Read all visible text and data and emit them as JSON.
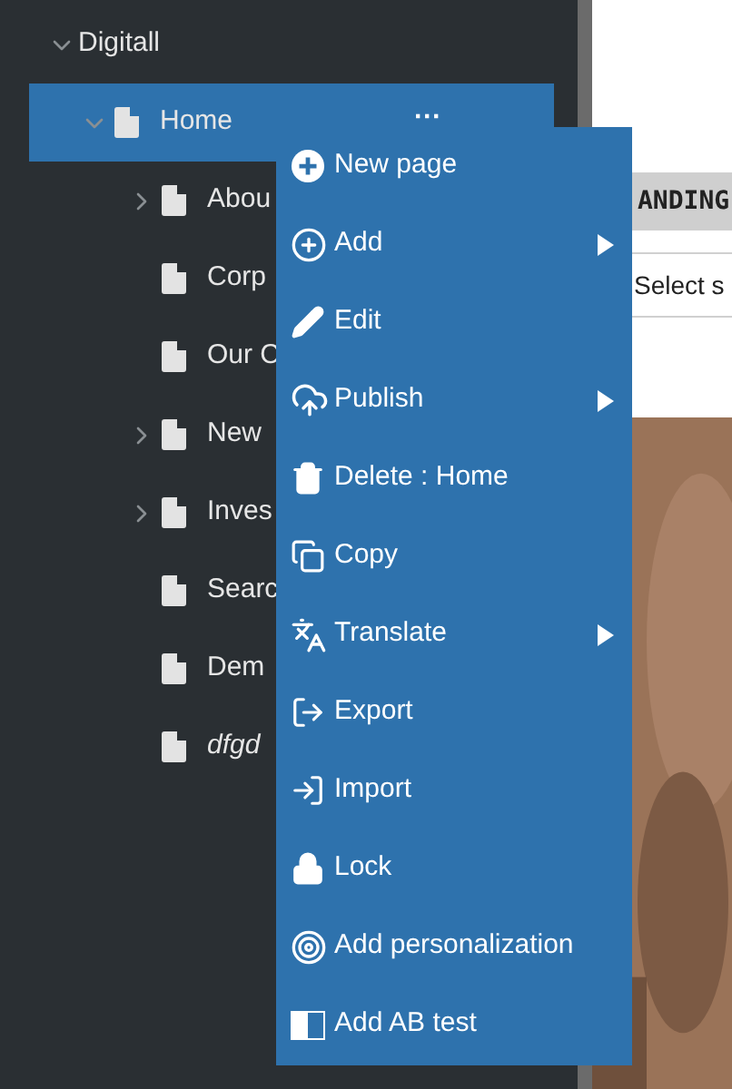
{
  "tree": [
    {
      "label": "Digitall",
      "expanded": true,
      "selected": false,
      "italic": false,
      "children": [
        {
          "label": "Home",
          "expanded": true,
          "selected": true,
          "italic": false,
          "more": "···",
          "children": [
            {
              "label": "Abou",
              "expanded": false,
              "selected": false,
              "italic": false
            },
            {
              "label": "Corp",
              "selected": false,
              "italic": false
            },
            {
              "label": "Our C",
              "selected": false,
              "italic": false
            },
            {
              "label": "New",
              "expanded": false,
              "selected": false,
              "italic": false
            },
            {
              "label": "Inves",
              "expanded": false,
              "selected": false,
              "italic": false
            },
            {
              "label": "Searc",
              "selected": false,
              "italic": false
            },
            {
              "label": "Dem",
              "selected": false,
              "italic": false
            },
            {
              "label": "dfgd",
              "selected": false,
              "italic": true
            }
          ]
        }
      ]
    }
  ],
  "content": {
    "header": "ANDING",
    "select": "Select s"
  },
  "context_menu": [
    {
      "label": "New page",
      "submenu": false
    },
    {
      "label": "Add",
      "submenu": true
    },
    {
      "label": "Edit",
      "submenu": false
    },
    {
      "label": "Publish",
      "submenu": true
    },
    {
      "label": "Delete : Home",
      "submenu": false
    },
    {
      "label": "Copy",
      "submenu": false
    },
    {
      "label": "Translate",
      "submenu": true
    },
    {
      "label": "Export",
      "submenu": false
    },
    {
      "label": "Import",
      "submenu": false
    },
    {
      "label": "Lock",
      "submenu": false
    },
    {
      "label": "Add personalization",
      "submenu": false
    },
    {
      "label": "Add AB test",
      "submenu": false
    }
  ]
}
